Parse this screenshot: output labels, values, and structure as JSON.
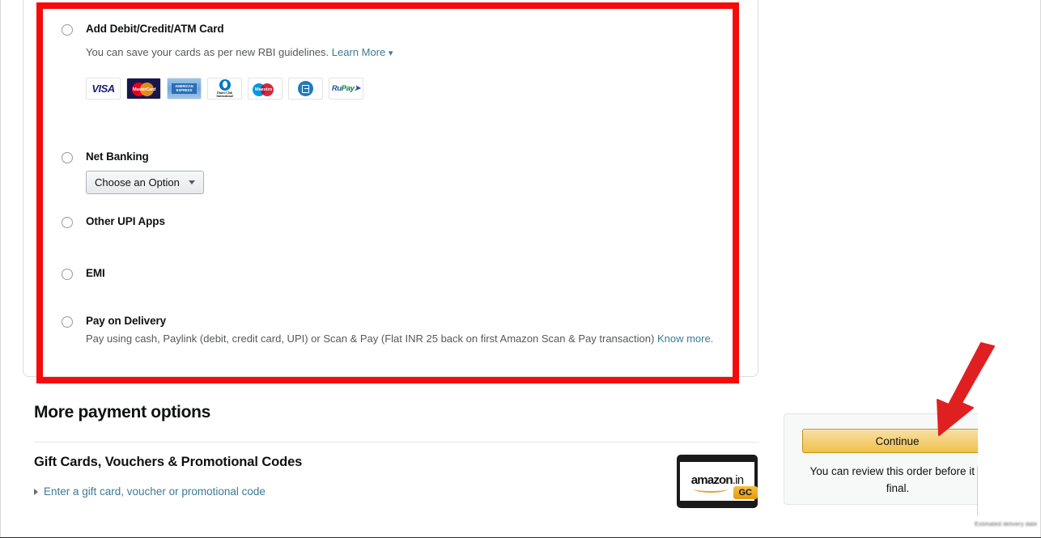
{
  "payment_methods": {
    "options": [
      {
        "id": "add-card",
        "label": "Add Debit/Credit/ATM Card",
        "sub": "You can save your cards as per new RBI guidelines.",
        "link": "Learn More",
        "chevron": "chevron-down-icon",
        "selected": false
      },
      {
        "id": "net-banking",
        "label": "Net Banking",
        "dropdown_value": "Choose an Option",
        "selected": false
      },
      {
        "id": "other-upi",
        "label": "Other UPI Apps",
        "selected": false
      },
      {
        "id": "emi",
        "label": "EMI",
        "selected": false
      },
      {
        "id": "pay-on-delivery",
        "label": "Pay on Delivery",
        "sub": "Pay using cash, Paylink (debit, credit card, UPI) or Scan & Pay (Flat INR 25 back on first Amazon Scan & Pay transaction)",
        "link": "Know more.",
        "selected": false
      }
    ],
    "card_networks": [
      {
        "name": "visa-logo",
        "text": "VISA"
      },
      {
        "name": "mastercard-logo",
        "text": "MasterCard"
      },
      {
        "name": "american-express-logo",
        "text": "AMERICAN EXPRESS"
      },
      {
        "name": "diners-club-logo",
        "text": "Diners Club International"
      },
      {
        "name": "maestro-logo",
        "text": "Maestro"
      },
      {
        "name": "bhim-upi-logo",
        "text": "BHIM"
      },
      {
        "name": "rupay-logo",
        "text": "RuPay"
      }
    ]
  },
  "more_payment": {
    "heading": "More payment options",
    "giftcard_heading": "Gift Cards, Vouchers & Promotional Codes",
    "giftcard_expander": "Enter a gift card, voucher or promotional code",
    "giftcard_image": {
      "brand": "amazon",
      "tld": ".in",
      "badge": "GC"
    }
  },
  "order_panel": {
    "continue_label": "Continue",
    "note": "You can review this order before it is final.",
    "blurred_footer": "Estimated delivery date"
  },
  "annotation": {
    "highlight_color": "#f50b0b",
    "arrow_color": "#e02020"
  }
}
